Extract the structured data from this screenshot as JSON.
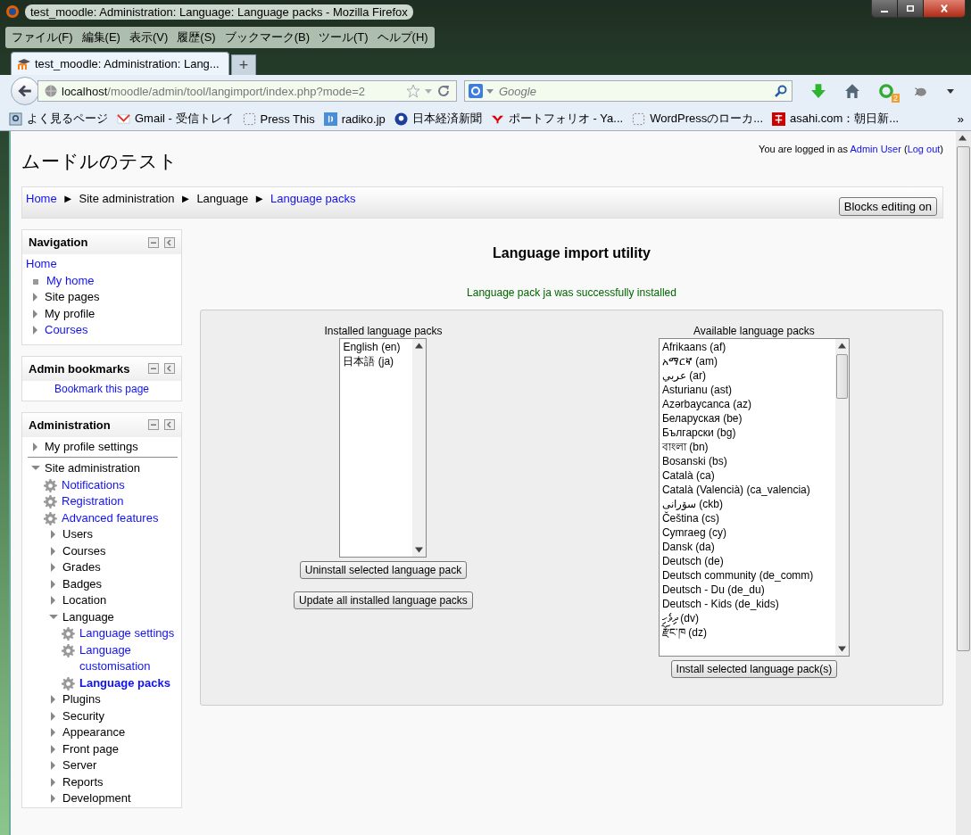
{
  "window": {
    "title": "test_moodle: Administration: Language: Language packs - Mozilla Firefox"
  },
  "menu_bar": [
    "ファイル(F)",
    "編集(E)",
    "表示(V)",
    "履歴(S)",
    "ブックマーク(B)",
    "ツール(T)",
    "ヘルプ(H)"
  ],
  "tabs": [
    {
      "label": "test_moodle: Administration: Lang...",
      "selected": true
    }
  ],
  "new_tab": "+",
  "address_bar": {
    "host": "localhost",
    "path": "/moodle/admin/tool/langimport/index.php?mode=2"
  },
  "search": {
    "placeholder": "Google"
  },
  "addon_badge": "2",
  "bookmarks": [
    {
      "label": "よく見るページ",
      "kind": "search"
    },
    {
      "label": "Gmail - 受信トレイ",
      "kind": "mail"
    },
    {
      "label": "Press This",
      "kind": "blank"
    },
    {
      "label": "radiko.jp",
      "kind": "radio"
    },
    {
      "label": "日本経済新聞",
      "kind": "news"
    },
    {
      "label": "ポートフォリオ - Ya...",
      "kind": "y"
    },
    {
      "label": "WordPressのローカ...",
      "kind": "blank"
    },
    {
      "label": "asahi.com：朝日新...",
      "kind": "asahi"
    }
  ],
  "bookmarks_more": "»",
  "site": {
    "title": "ムードルのテスト",
    "login": {
      "prefix": "You are logged in as",
      "user": "Admin User",
      "open": "(",
      "logout": "Log out",
      "close": ")"
    }
  },
  "breadcrumb": {
    "separator": "►",
    "items": [
      {
        "label": "Home",
        "link": true
      },
      {
        "label": "Site administration",
        "link": false
      },
      {
        "label": "Language",
        "link": false
      },
      {
        "label": "Language packs",
        "link": true
      }
    ]
  },
  "blocks_editing_button": "Blocks editing on",
  "navigation": {
    "title": "Navigation",
    "items": [
      {
        "label": "Home",
        "kind": "plain",
        "link": true
      },
      {
        "label": "My home",
        "kind": "bullet",
        "link": true
      },
      {
        "label": "Site pages",
        "kind": "branch",
        "expanded": false,
        "link": false
      },
      {
        "label": "My profile",
        "kind": "branch",
        "expanded": false,
        "link": false
      },
      {
        "label": "Courses",
        "kind": "branch",
        "expanded": false,
        "link": true
      }
    ]
  },
  "admin_bookmarks": {
    "title": "Admin bookmarks",
    "link": "Bookmark this page"
  },
  "administration": {
    "title": "Administration",
    "items": [
      {
        "label": "My profile settings",
        "kind": "branch",
        "expanded": false,
        "link": false
      },
      {
        "label": "Site administration",
        "kind": "branch",
        "expanded": true,
        "link": false,
        "children": [
          {
            "label": "Notifications",
            "kind": "gear",
            "link": true
          },
          {
            "label": "Registration",
            "kind": "gear",
            "link": true
          },
          {
            "label": "Advanced features",
            "kind": "gear",
            "link": true
          },
          {
            "label": "Users",
            "kind": "branch",
            "expanded": false,
            "link": false
          },
          {
            "label": "Courses",
            "kind": "branch",
            "expanded": false,
            "link": false
          },
          {
            "label": "Grades",
            "kind": "branch",
            "expanded": false,
            "link": false
          },
          {
            "label": "Badges",
            "kind": "branch",
            "expanded": false,
            "link": false
          },
          {
            "label": "Location",
            "kind": "branch",
            "expanded": false,
            "link": false
          },
          {
            "label": "Language",
            "kind": "branch",
            "expanded": true,
            "link": false,
            "children": [
              {
                "label": "Language settings",
                "kind": "gear",
                "link": true
              },
              {
                "label": "Language customisation",
                "kind": "gear",
                "link": true
              },
              {
                "label": "Language packs",
                "kind": "gear",
                "link": true,
                "current": true
              }
            ]
          },
          {
            "label": "Plugins",
            "kind": "branch",
            "expanded": false,
            "link": false
          },
          {
            "label": "Security",
            "kind": "branch",
            "expanded": false,
            "link": false
          },
          {
            "label": "Appearance",
            "kind": "branch",
            "expanded": false,
            "link": false
          },
          {
            "label": "Front page",
            "kind": "branch",
            "expanded": false,
            "link": false
          },
          {
            "label": "Server",
            "kind": "branch",
            "expanded": false,
            "link": false
          },
          {
            "label": "Reports",
            "kind": "branch",
            "expanded": false,
            "link": false
          },
          {
            "label": "Development",
            "kind": "branch",
            "expanded": false,
            "link": false
          }
        ]
      }
    ]
  },
  "main": {
    "heading": "Language import utility",
    "notice": "Language pack ja was successfully installed",
    "installed": {
      "label": "Installed language packs",
      "options": [
        "English (en)",
        "日本語 (ja)"
      ],
      "buttons": [
        "Uninstall selected language pack",
        "Update all installed language packs"
      ]
    },
    "available": {
      "label": "Available language packs",
      "options": [
        "Afrikaans (af)",
        "አማርኛ (am)",
        "عربي (ar)",
        "Asturianu (ast)",
        "Azərbaycanca (az)",
        "Беларуская (be)",
        "Български (bg)",
        "বাংলা (bn)",
        "Bosanski (bs)",
        "Català (ca)",
        "Català (Valencià) (ca_valencia)",
        "سۆرانی (ckb)",
        "Čeština (cs)",
        "Cymraeg (cy)",
        "Dansk (da)",
        "Deutsch (de)",
        "Deutsch community (de_comm)",
        "Deutsch - Du (de_du)",
        "Deutsch - Kids (de_kids)",
        "ދިވެހި (dv)",
        "རྫོང་ཁ (dz)"
      ],
      "buttons": [
        "Install selected language pack(s)"
      ]
    }
  }
}
